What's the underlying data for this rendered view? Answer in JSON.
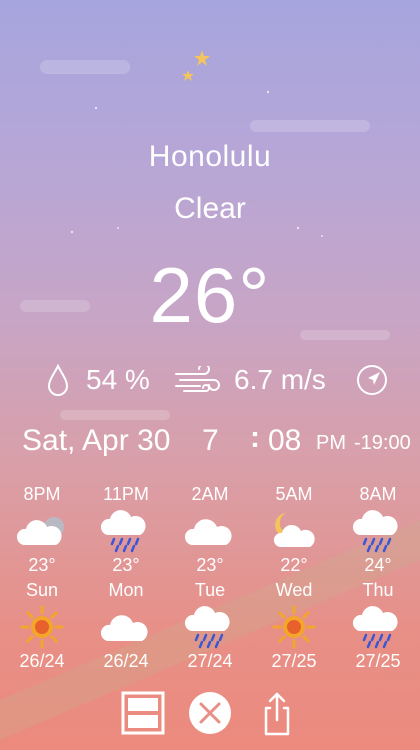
{
  "location": {
    "city": "Honolulu",
    "condition": "Clear",
    "temperature": "26°"
  },
  "stats": {
    "humidity": "54 %",
    "wind": "6.7 m/s",
    "humidity_icon": "droplet-icon",
    "wind_icon": "wind-icon",
    "direction_icon": "compass-arrow-icon"
  },
  "datetime": {
    "date": "Sat, Apr 30",
    "hour": "7",
    "colon": ":",
    "minutes": "08",
    "ampm": "PM",
    "offset": "-19:00"
  },
  "hourly": [
    {
      "time": "8PM",
      "icon": "cloud-partly-gray-icon",
      "temp": "23°"
    },
    {
      "time": "11PM",
      "icon": "cloud-rain-icon",
      "temp": "23°"
    },
    {
      "time": "2AM",
      "icon": "cloud-icon",
      "temp": "23°"
    },
    {
      "time": "5AM",
      "icon": "moon-cloud-icon",
      "temp": "22°"
    },
    {
      "time": "8AM",
      "icon": "cloud-rain-icon",
      "temp": "24°"
    }
  ],
  "daily": [
    {
      "day": "Sun",
      "icon": "sun-icon",
      "range": "26/24"
    },
    {
      "day": "Mon",
      "icon": "cloud-icon",
      "range": "26/24"
    },
    {
      "day": "Tue",
      "icon": "cloud-rain-icon",
      "range": "27/24"
    },
    {
      "day": "Wed",
      "icon": "sun-icon",
      "range": "27/25"
    },
    {
      "day": "Thu",
      "icon": "cloud-rain-icon",
      "range": "27/25"
    }
  ],
  "toolbar": {
    "layout_icon": "layout-split-icon",
    "close_icon": "close-circle-icon",
    "share_icon": "share-icon"
  },
  "colors": {
    "moon": "#f5c45a",
    "sun": "#f4a62a",
    "sun_core": "#e8612c",
    "rain": "#3c57d6",
    "text": "#ffffff"
  }
}
